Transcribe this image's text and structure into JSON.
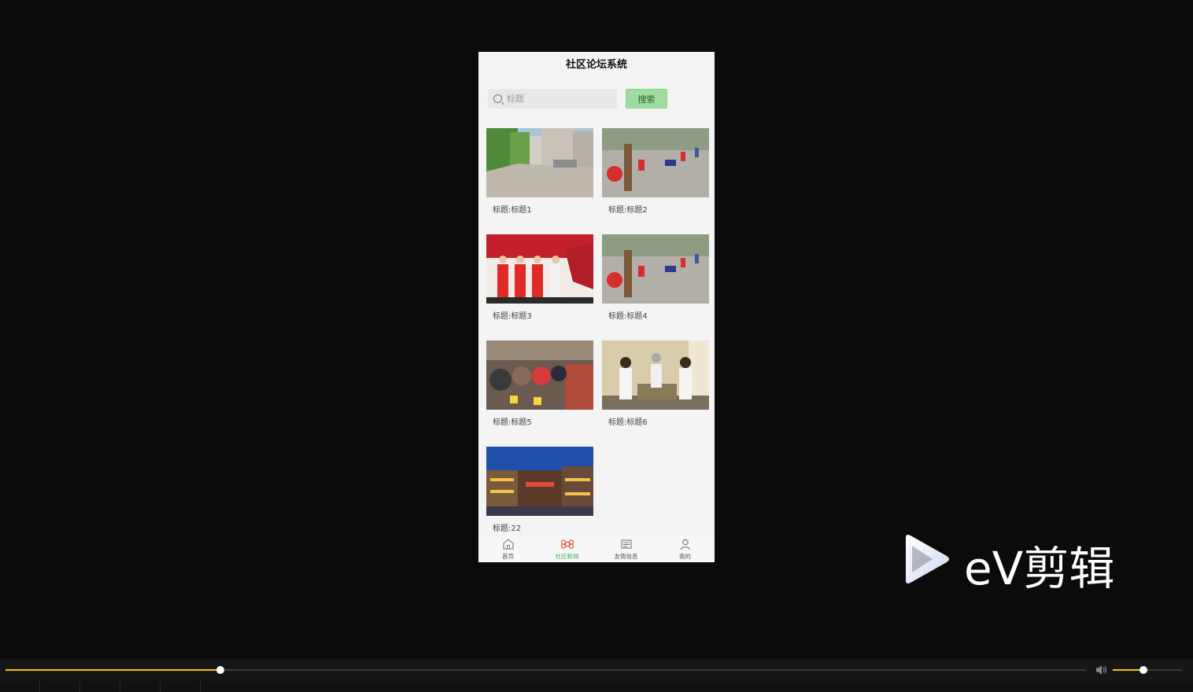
{
  "app": {
    "title": "社区论坛系统"
  },
  "search": {
    "placeholder": "标题",
    "button_label": "搜索"
  },
  "posts": [
    {
      "title": "标题:标题1",
      "image": "street-scene-image"
    },
    {
      "title": "标题:标题2",
      "image": "volunteers-cleaning-image"
    },
    {
      "title": "标题:标题3",
      "image": "group-photo-red-vests-image"
    },
    {
      "title": "标题:标题4",
      "image": "volunteers-cleaning-image"
    },
    {
      "title": "标题:标题5",
      "image": "elderly-gathering-image"
    },
    {
      "title": "标题:标题6",
      "image": "indoor-activity-image"
    },
    {
      "title": "标题:22",
      "image": "night-shopping-street-image"
    }
  ],
  "tabbar": {
    "items": [
      {
        "label": "首页",
        "icon": "home-icon"
      },
      {
        "label": "社区新闻",
        "icon": "command-icon",
        "active": true
      },
      {
        "label": "友情信息",
        "icon": "newspaper-icon"
      },
      {
        "label": "我的",
        "icon": "user-icon"
      }
    ]
  },
  "player": {
    "progress": 0.199,
    "volume": 0.44
  },
  "watermark": {
    "text": "eV剪辑"
  },
  "colors": {
    "accent_green": "#4caf50",
    "seek_yellow": "#f5c400",
    "button_green": "#9fdca0"
  }
}
